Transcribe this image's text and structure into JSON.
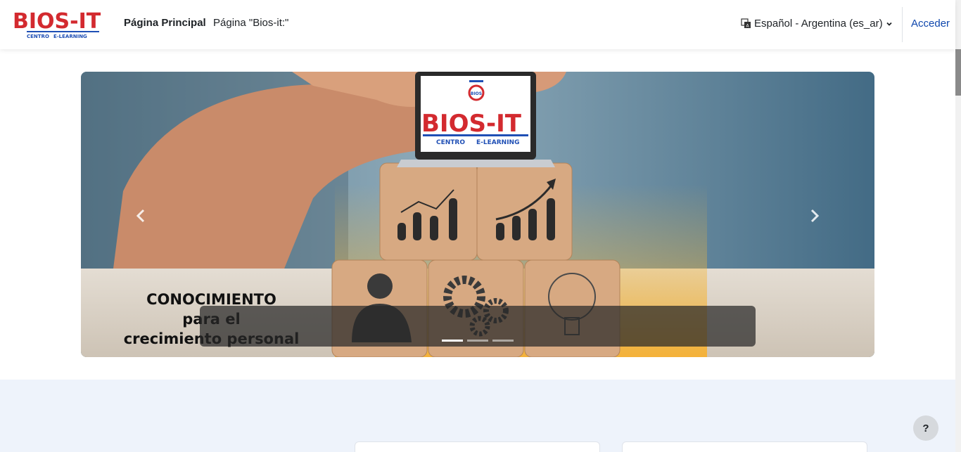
{
  "navbar": {
    "logo": {
      "brand": "BIOS-IT",
      "sub_left": "CENTRO",
      "sub_right": "E-LEARNING"
    },
    "links": [
      {
        "label": "Página Principal"
      },
      {
        "label": "Página \"Bios-it:\""
      }
    ],
    "language": {
      "label": "Español - Argentina (es_ar)",
      "icon": "language-icon"
    },
    "login_label": "Acceder"
  },
  "carousel": {
    "slide": {
      "caption_lines": [
        "CONOCIMIENTO",
        "para el",
        "crecimiento personal"
      ],
      "laptop_brand": "BIOS-IT",
      "laptop_sub_left": "CENTRO",
      "laptop_sub_right": "E-LEARNING",
      "laptop_badge": "BIOS"
    },
    "indicators": 3,
    "active_indicator": 0
  },
  "help_button": {
    "label": "?"
  },
  "colors": {
    "brand_red": "#d32a2f",
    "brand_blue": "#1f4fb5",
    "link": "#0f47ad",
    "section_bg": "#eef3fb"
  }
}
